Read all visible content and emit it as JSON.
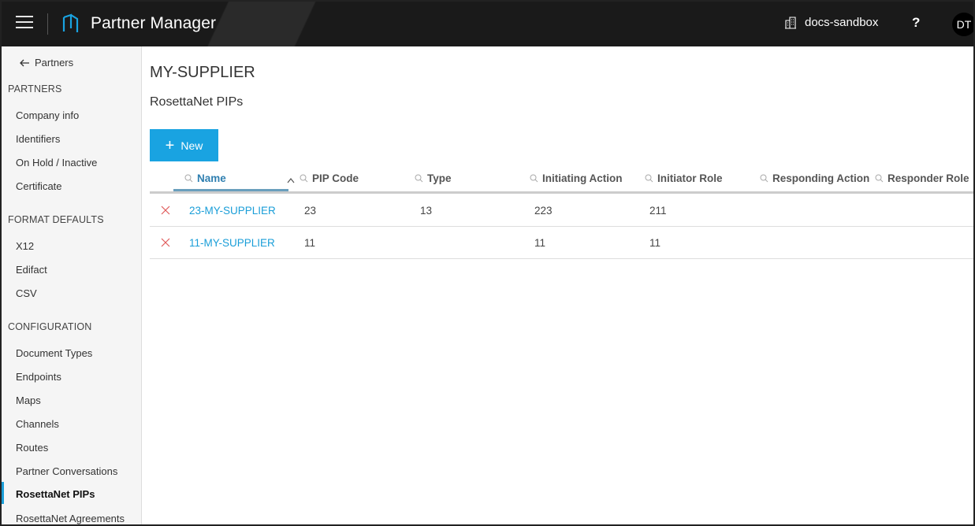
{
  "header": {
    "app_title": "Partner Manager",
    "environment": "docs-sandbox",
    "help": "?",
    "avatar_initials": "DT",
    "menu_icon": "hamburger-menu-icon",
    "logo_icon": "partner-manager-logo-icon",
    "environment_icon": "building-icon"
  },
  "sidebar": {
    "back_label": "Partners",
    "sections": [
      {
        "title": "PARTNERS",
        "items": [
          "Company info",
          "Identifiers",
          "On Hold / Inactive",
          "Certificate"
        ]
      },
      {
        "title": "FORMAT DEFAULTS",
        "items": [
          "X12",
          "Edifact",
          "CSV"
        ]
      },
      {
        "title": "CONFIGURATION",
        "items": [
          "Document Types",
          "Endpoints",
          "Maps",
          "Channels",
          "Routes",
          "Partner Conversations",
          "RosettaNet PIPs",
          "RosettaNet Agreements"
        ]
      }
    ],
    "active_item": "RosettaNet PIPs"
  },
  "main": {
    "partner_name": "MY-SUPPLIER",
    "section_title": "RosettaNet PIPs",
    "new_button_label": "New",
    "columns": [
      "Name",
      "PIP Code",
      "Type",
      "Initiating Action",
      "Initiator Role",
      "Responding Action",
      "Responder Role"
    ],
    "sorted_column": "Name",
    "sort_direction": "ascending",
    "rows": [
      {
        "name": "23-MY-SUPPLIER",
        "pip_code": "23",
        "type": "13",
        "initiating_action": "223",
        "initiator_role": "211",
        "responding_action": "",
        "responder_role": ""
      },
      {
        "name": "11-MY-SUPPLIER",
        "pip_code": "11",
        "type": "",
        "initiating_action": "11",
        "initiator_role": "11",
        "responding_action": "",
        "responder_role": ""
      }
    ]
  },
  "colors": {
    "accent": "#19a3e1",
    "link": "#1a9ed8",
    "topbar": "#1c1c1c",
    "delete": "#e05a5a"
  }
}
